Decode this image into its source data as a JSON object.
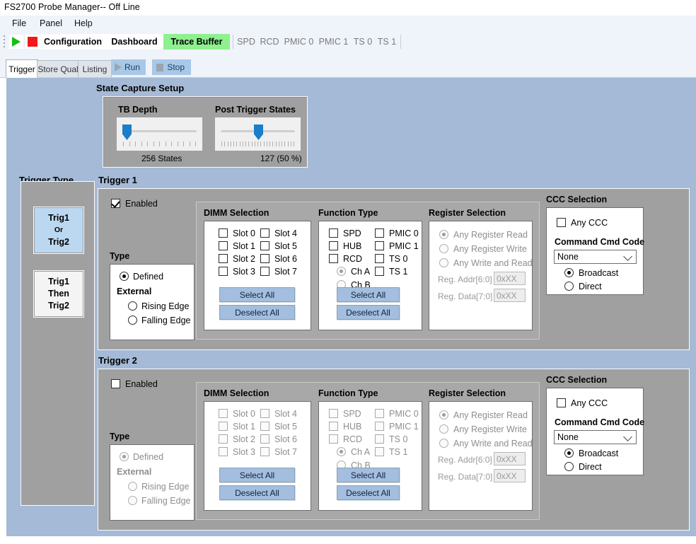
{
  "window": {
    "title": "FS2700 Probe Manager-- Off Line"
  },
  "menu": {
    "items": [
      {
        "label": "File"
      },
      {
        "label": "Panel"
      },
      {
        "label": "Help"
      }
    ]
  },
  "toolbar": {
    "play_icon": "play-icon",
    "stop_icon": "stop-icon",
    "buttons": [
      {
        "label": "Configuration",
        "state": "normal"
      },
      {
        "label": "Dashboard",
        "state": "normal"
      },
      {
        "label": "Trace Buffer",
        "state": "active"
      },
      {
        "label": "SPD",
        "state": "disabled"
      },
      {
        "label": "RCD",
        "state": "disabled"
      },
      {
        "label": "PMIC 0",
        "state": "disabled"
      },
      {
        "label": "PMIC 1",
        "state": "disabled"
      },
      {
        "label": "TS 0",
        "state": "disabled"
      },
      {
        "label": "TS 1",
        "state": "disabled"
      }
    ],
    "active_color": "#8ef08e"
  },
  "tabs": {
    "items": [
      {
        "label": "Trigger",
        "active": true
      },
      {
        "label": "Store Qual",
        "active": false
      },
      {
        "label": "Listing",
        "active": false
      }
    ],
    "run": {
      "label": "Run",
      "icon": "play-icon",
      "enabled": false
    },
    "stop": {
      "label": "Stop",
      "icon": "stop-icon",
      "enabled": false
    }
  },
  "state_capture": {
    "caption": "State Capture Setup",
    "tb_depth": {
      "label": "TB Depth",
      "value_text": "256 States",
      "thumb_percent": 4
    },
    "post_trigger": {
      "label": "Post Trigger States",
      "value_text": "127 (50 %)",
      "thumb_percent": 50
    }
  },
  "trigger_type": {
    "caption": "Trigger Type",
    "options": [
      {
        "line1": "Trig1",
        "line2": "Or",
        "line3": "Trig2",
        "selected": true
      },
      {
        "line1": "Trig1",
        "line2": "Then",
        "line3": "Trig2",
        "selected": false
      }
    ]
  },
  "trigger1": {
    "caption": "Trigger 1",
    "enabled_label": "Enabled",
    "enabled": true,
    "type": {
      "caption": "Type",
      "defined_label": "Defined",
      "external_label": "External",
      "rising_label": "Rising Edge",
      "falling_label": "Falling Edge",
      "selected": "Defined"
    },
    "dimm": {
      "caption": "DIMM Selection",
      "slots_left": [
        "Slot 0",
        "Slot 1",
        "Slot 2",
        "Slot 3"
      ],
      "slots_right": [
        "Slot 4",
        "Slot 5",
        "Slot 6",
        "Slot 7"
      ],
      "select_all": "Select All",
      "deselect_all": "Deselect All"
    },
    "function": {
      "caption": "Function Type",
      "left": [
        "SPD",
        "HUB",
        "RCD"
      ],
      "right": [
        "PMIC 0",
        "PMIC 1",
        "TS 0",
        "TS 1"
      ],
      "channel_a": "Ch A",
      "channel_b": "Ch B",
      "channel_selected": "Ch A",
      "select_all": "Select All",
      "deselect_all": "Deselect All"
    },
    "register": {
      "caption": "Register Selection",
      "any_read": "Any Register Read",
      "any_write": "Any Register Write",
      "any_write_read": "Any Write and Read",
      "selected": "Any Register Read",
      "addr_label": "Reg. Addr[6:0]",
      "addr_value": "0xXX",
      "data_label": "Reg. Data[7:0]",
      "data_value": "0xXX"
    },
    "ccc": {
      "caption": "CCC Selection",
      "any_ccc_label": "Any CCC",
      "any_ccc_checked": false,
      "cmd_caption": "Command Cmd Code",
      "cmd_value": "None",
      "broadcast_label": "Broadcast",
      "direct_label": "Direct",
      "mode_selected": "Broadcast"
    }
  },
  "trigger2": {
    "caption": "Trigger 2",
    "enabled_label": "Enabled",
    "enabled": false,
    "type": {
      "caption": "Type",
      "defined_label": "Defined",
      "external_label": "External",
      "rising_label": "Rising Edge",
      "falling_label": "Falling Edge",
      "selected": "Defined"
    },
    "dimm": {
      "caption": "DIMM Selection",
      "slots_left": [
        "Slot 0",
        "Slot 1",
        "Slot 2",
        "Slot 3"
      ],
      "slots_right": [
        "Slot 4",
        "Slot 5",
        "Slot 6",
        "Slot 7"
      ],
      "select_all": "Select All",
      "deselect_all": "Deselect All"
    },
    "function": {
      "caption": "Function Type",
      "left": [
        "SPD",
        "HUB",
        "RCD"
      ],
      "right": [
        "PMIC 0",
        "PMIC 1",
        "TS 0",
        "TS 1"
      ],
      "channel_a": "Ch A",
      "channel_b": "Ch B",
      "channel_selected": "Ch A",
      "select_all": "Select All",
      "deselect_all": "Deselect All"
    },
    "register": {
      "caption": "Register Selection",
      "any_read": "Any Register Read",
      "any_write": "Any Register Write",
      "any_write_read": "Any Write and Read",
      "selected": "Any Register Read",
      "addr_label": "Reg. Addr[6:0]",
      "addr_value": "0xXX",
      "data_label": "Reg. Data[7:0]",
      "data_value": "0xXX"
    },
    "ccc": {
      "caption": "CCC Selection",
      "any_ccc_label": "Any CCC",
      "any_ccc_checked": false,
      "cmd_caption": "Command Cmd Code",
      "cmd_value": "None",
      "broadcast_label": "Broadcast",
      "direct_label": "Direct",
      "mode_selected": "Broadcast"
    }
  },
  "colors": {
    "panel_blue": "#a4bad6",
    "group_grey": "#a0a0a0",
    "button_blue": "#a3bede",
    "accent_green": "#8ef08e",
    "slider_blue": "#1a7ec8"
  }
}
